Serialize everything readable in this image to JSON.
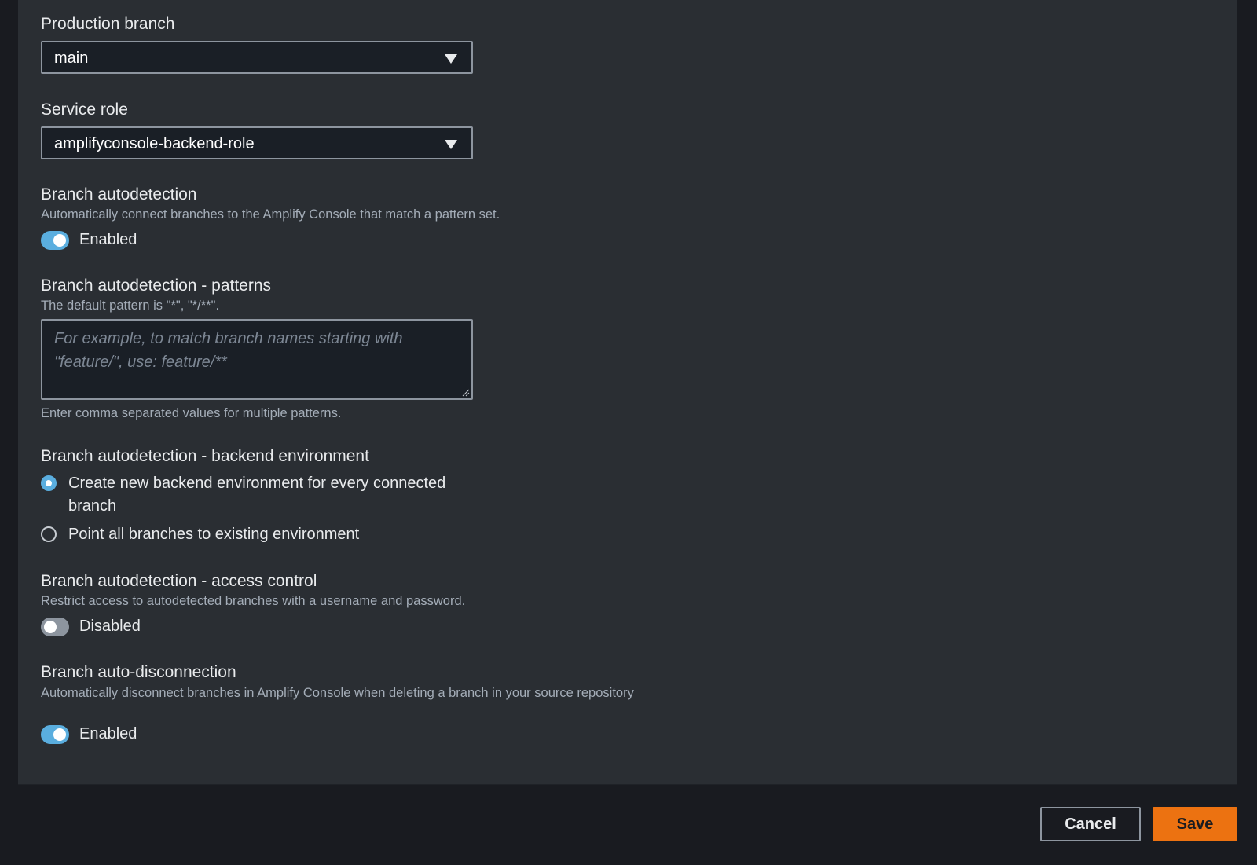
{
  "production_branch": {
    "label": "Production branch",
    "value": "main"
  },
  "service_role": {
    "label": "Service role",
    "value": "amplifyconsole-backend-role"
  },
  "branch_autodetection": {
    "label": "Branch autodetection",
    "description": "Automatically connect branches to the Amplify Console that match a pattern set.",
    "toggle_label": "Enabled",
    "enabled": true
  },
  "patterns": {
    "label": "Branch autodetection - patterns",
    "description": "The default pattern is \"*\", \"*/**\".",
    "placeholder": "For example, to match branch names starting with \"feature/\", use: feature/**",
    "hint": "Enter comma separated values for multiple patterns."
  },
  "backend_environment": {
    "label": "Branch autodetection - backend environment",
    "options": [
      {
        "label": "Create new backend environment for every connected branch",
        "selected": true
      },
      {
        "label": "Point all branches to existing environment",
        "selected": false
      }
    ]
  },
  "access_control": {
    "label": "Branch autodetection - access control",
    "description": "Restrict access to autodetected branches with a username and password.",
    "toggle_label": "Disabled",
    "enabled": false
  },
  "auto_disconnection": {
    "label": "Branch auto-disconnection",
    "description": "Automatically disconnect branches in Amplify Console when deleting a branch in your source repository",
    "toggle_label": "Enabled",
    "enabled": true
  },
  "footer": {
    "cancel_label": "Cancel",
    "save_label": "Save"
  },
  "colors": {
    "accent_blue": "#5aaedf",
    "primary_orange": "#ec7211",
    "panel_bg": "#2a2e33",
    "page_bg": "#191b20"
  },
  "icons": {
    "dropdown": "caret-down-icon",
    "resize": "resize-handle-icon"
  }
}
